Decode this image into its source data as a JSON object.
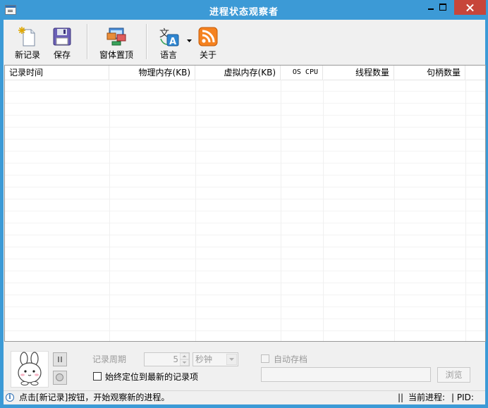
{
  "window": {
    "title": "进程状态观察者"
  },
  "toolbar": {
    "new_record": "新记录",
    "save": "保存",
    "window_top": "窗体置顶",
    "language": "语言",
    "about": "关于"
  },
  "list": {
    "columns": [
      "记录时间",
      "物理内存(KB)",
      "虚拟内存(KB)",
      "OS CPU",
      "线程数量",
      "句柄数量"
    ]
  },
  "bottom": {
    "record_period_label": "记录周期",
    "period_value": "5",
    "period_unit": "秒钟",
    "auto_save_label": "自动存档",
    "follow_latest_label": "始终定位到最新的记录项",
    "browse": "浏览"
  },
  "status": {
    "message": "点击[新记录]按钮，开始观察新的进程。",
    "separator": "||",
    "current_process": "当前进程:",
    "pid": "| PID:"
  },
  "icons": {
    "new_record": "new-document-icon",
    "save": "floppy-disk-icon",
    "window_top": "window-pin-icon",
    "language": "translate-icon",
    "about": "rss-icon"
  }
}
